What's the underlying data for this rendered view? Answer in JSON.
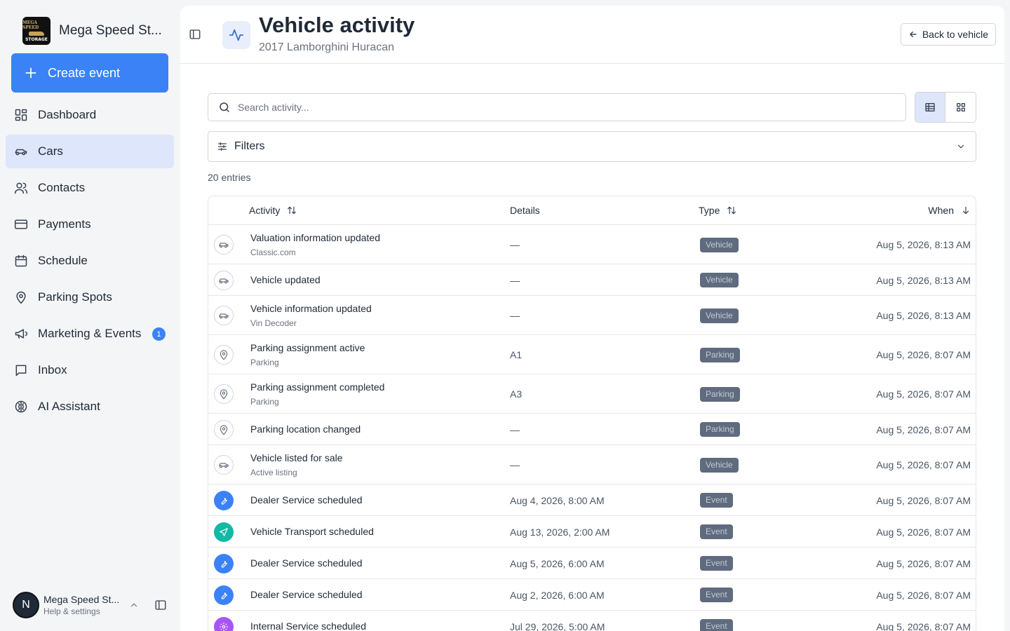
{
  "brand": {
    "name": "Mega Speed St...",
    "logo_top": "MEGA SPEED",
    "logo_bottom": "STORAGE"
  },
  "sidebar": {
    "create_label": "Create event",
    "items": [
      {
        "label": "Dashboard",
        "icon": "dashboard-icon"
      },
      {
        "label": "Cars",
        "icon": "car-icon",
        "active": true
      },
      {
        "label": "Contacts",
        "icon": "contacts-icon"
      },
      {
        "label": "Payments",
        "icon": "card-icon"
      },
      {
        "label": "Schedule",
        "icon": "calendar-icon"
      },
      {
        "label": "Parking Spots",
        "icon": "map-pin-icon"
      },
      {
        "label": "Marketing & Events",
        "icon": "megaphone-icon",
        "badge": "1"
      },
      {
        "label": "Inbox",
        "icon": "message-icon"
      },
      {
        "label": "AI Assistant",
        "icon": "brain-icon"
      }
    ],
    "user": {
      "initial": "N",
      "name": "Mega Speed St...",
      "sub": "Help & settings"
    }
  },
  "header": {
    "title": "Vehicle activity",
    "subtitle": "2017 Lamborghini Huracan",
    "back_label": "Back to vehicle"
  },
  "search": {
    "placeholder": "Search activity..."
  },
  "filters": {
    "label": "Filters"
  },
  "entries_label": "20 entries",
  "table": {
    "columns": {
      "activity": "Activity",
      "details": "Details",
      "type": "Type",
      "when": "When"
    },
    "rows": [
      {
        "icon": "car",
        "title": "Valuation information updated",
        "sub": "Classic.com",
        "detail": "—",
        "type": "Vehicle",
        "when": "Aug 5, 2026, 8:13 AM"
      },
      {
        "icon": "car",
        "title": "Vehicle updated",
        "sub": "",
        "detail": "—",
        "type": "Vehicle",
        "when": "Aug 5, 2026, 8:13 AM"
      },
      {
        "icon": "car",
        "title": "Vehicle information updated",
        "sub": "Vin Decoder",
        "detail": "—",
        "type": "Vehicle",
        "when": "Aug 5, 2026, 8:13 AM"
      },
      {
        "icon": "pin",
        "title": "Parking assignment active",
        "sub": "Parking",
        "detail": "A1",
        "type": "Parking",
        "when": "Aug 5, 2026, 8:07 AM"
      },
      {
        "icon": "pin",
        "title": "Parking assignment completed",
        "sub": "Parking",
        "detail": "A3",
        "type": "Parking",
        "when": "Aug 5, 2026, 8:07 AM"
      },
      {
        "icon": "pin",
        "title": "Parking location changed",
        "sub": "",
        "detail": "—",
        "type": "Parking",
        "when": "Aug 5, 2026, 8:07 AM"
      },
      {
        "icon": "car",
        "title": "Vehicle listed for sale",
        "sub": "Active listing",
        "detail": "—",
        "type": "Vehicle",
        "when": "Aug 5, 2026, 8:07 AM"
      },
      {
        "icon": "wrench",
        "title": "Dealer Service scheduled",
        "sub": "",
        "detail": "Aug 4, 2026, 8:00 AM",
        "type": "Event",
        "when": "Aug 5, 2026, 8:07 AM"
      },
      {
        "icon": "send",
        "title": "Vehicle Transport scheduled",
        "sub": "",
        "detail": "Aug 13, 2026, 2:00 AM",
        "type": "Event",
        "when": "Aug 5, 2026, 8:07 AM"
      },
      {
        "icon": "wrench",
        "title": "Dealer Service scheduled",
        "sub": "",
        "detail": "Aug 5, 2026, 6:00 AM",
        "type": "Event",
        "when": "Aug 5, 2026, 8:07 AM"
      },
      {
        "icon": "wrench",
        "title": "Dealer Service scheduled",
        "sub": "",
        "detail": "Aug 2, 2026, 6:00 AM",
        "type": "Event",
        "when": "Aug 5, 2026, 8:07 AM"
      },
      {
        "icon": "gear",
        "title": "Internal Service scheduled",
        "sub": "",
        "detail": "Jul 29, 2026, 5:00 AM",
        "type": "Event",
        "when": "Aug 5, 2026, 8:07 AM"
      }
    ]
  },
  "colors": {
    "accent": "#3b82f6",
    "active_nav": "#dde6fb",
    "badge_bg": "#5f6b7e",
    "icon_wrench": "#3b82f6",
    "icon_send": "#14b8a6",
    "icon_gear": "#a855f7"
  }
}
